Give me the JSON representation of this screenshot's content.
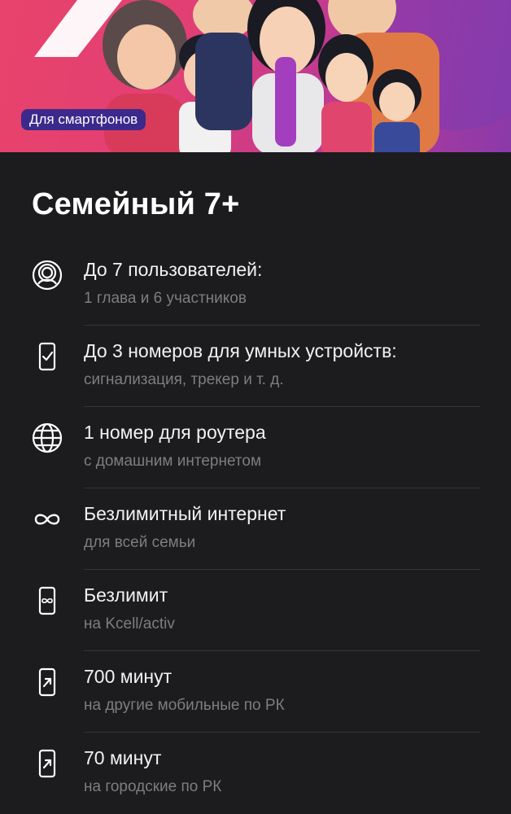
{
  "hero": {
    "badge": "Для смартфонов"
  },
  "plan": {
    "title": "Семейный 7+"
  },
  "features": [
    {
      "icon": "user-circle-icon",
      "title": "До 7 пользователей:",
      "subtitle": "1 глава и 6 участников"
    },
    {
      "icon": "device-check-icon",
      "title": "До 3 номеров для умных устройств:",
      "subtitle": "сигнализация, трекер и т. д."
    },
    {
      "icon": "globe-icon",
      "title": "1 номер для роутера",
      "subtitle": "с домашним интернетом"
    },
    {
      "icon": "infinity-icon",
      "title": "Безлимитный интернет",
      "subtitle": "для всей семьи"
    },
    {
      "icon": "phone-infinity-icon",
      "title": "Безлимит",
      "subtitle": "на Kcell/activ"
    },
    {
      "icon": "phone-outgoing-icon",
      "title": "700 минут",
      "subtitle": "на другие мобильные по РК"
    },
    {
      "icon": "phone-outgoing-icon",
      "title": "70 минут",
      "subtitle": "на городские по РК"
    }
  ]
}
